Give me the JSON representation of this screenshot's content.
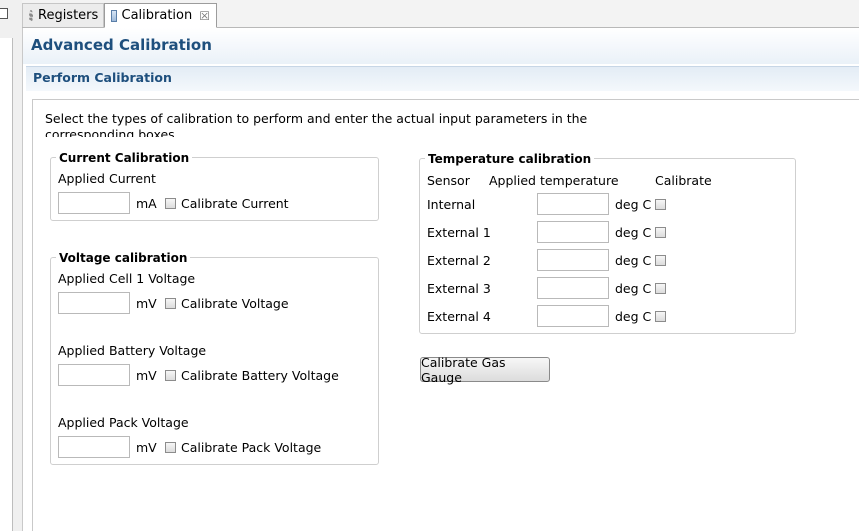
{
  "tabs": [
    {
      "label": "Registers",
      "icon": "gear-icon"
    },
    {
      "label": "Calibration",
      "icon": "calibration-icon",
      "close": "☒"
    }
  ],
  "page": {
    "title": "Advanced Calibration",
    "section_title": "Perform Calibration",
    "instructions": "Select the types of calibration to perform and enter the actual input parameters in the corresponding boxes"
  },
  "current_calibration": {
    "legend": "Current Calibration",
    "applied_label": "Applied Current",
    "value": "",
    "unit": "mA",
    "checkbox_label": "Calibrate Current"
  },
  "voltage_calibration": {
    "legend": "Voltage calibration",
    "cell1": {
      "label": "Applied Cell 1 Voltage",
      "value": "",
      "unit": "mV",
      "checkbox_label": "Calibrate Voltage"
    },
    "battery": {
      "label": "Applied Battery Voltage",
      "value": "",
      "unit": "mV",
      "checkbox_label": "Calibrate Battery Voltage"
    },
    "pack": {
      "label": "Applied Pack Voltage",
      "value": "",
      "unit": "mV",
      "checkbox_label": "Calibrate Pack Voltage"
    }
  },
  "temperature_calibration": {
    "legend": "Temperature calibration",
    "headers": {
      "sensor": "Sensor",
      "applied": "Applied temperature",
      "calibrate": "Calibrate"
    },
    "rows": [
      {
        "sensor": "Internal",
        "value": "",
        "unit": "deg C"
      },
      {
        "sensor": "External 1",
        "value": "",
        "unit": "deg C"
      },
      {
        "sensor": "External 2",
        "value": "",
        "unit": "deg C"
      },
      {
        "sensor": "External 3",
        "value": "",
        "unit": "deg C"
      },
      {
        "sensor": "External 4",
        "value": "",
        "unit": "deg C"
      }
    ]
  },
  "actions": {
    "calibrate_button": "Calibrate Gas Gauge"
  }
}
